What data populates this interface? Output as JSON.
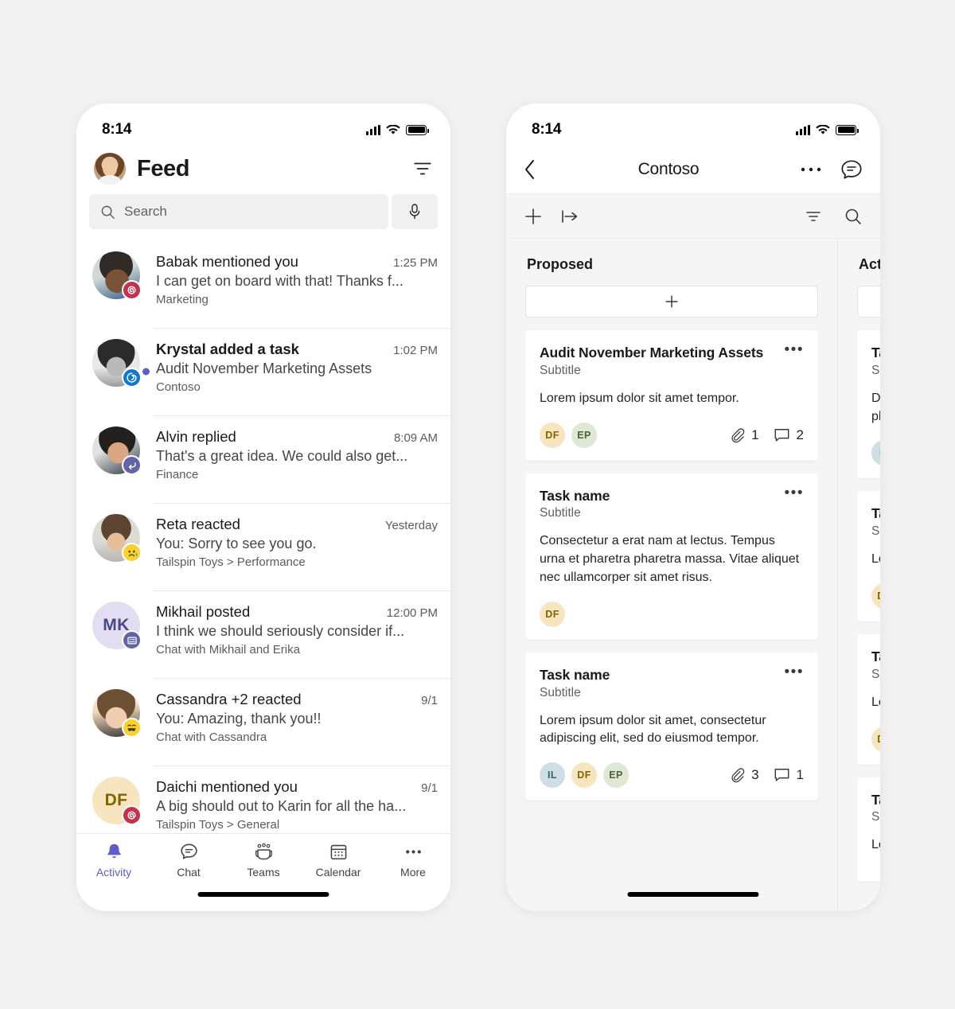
{
  "status_bar": {
    "time": "8:14"
  },
  "feed_screen": {
    "title": "Feed",
    "filter_icon": "filter-icon",
    "search": {
      "placeholder": "Search",
      "icon": "search-icon",
      "mic_icon": "microphone-icon"
    },
    "items": [
      {
        "title": "Babak mentioned you",
        "preview": "I can get on board with that! Thanks f...",
        "context": "Marketing",
        "time": "1:25 PM",
        "bold": false,
        "unread": false,
        "badge": "mention-icon",
        "badge_color": "#c4314b",
        "avatar_type": "photo",
        "photo": "babak"
      },
      {
        "title": "Krystal added a task",
        "preview": "Audit November Marketing Assets",
        "context": "Contoso",
        "time": "1:02 PM",
        "bold": true,
        "unread": true,
        "badge": "planner-task-icon",
        "badge_color": "#0f78d4",
        "avatar_type": "photo",
        "photo": "krystal"
      },
      {
        "title": "Alvin replied",
        "preview": "That's a great idea. We could also get...",
        "context": "Finance",
        "time": "8:09 AM",
        "bold": false,
        "unread": false,
        "badge": "reply-icon",
        "badge_color": "#6264a7",
        "avatar_type": "photo",
        "photo": "alvin"
      },
      {
        "title": "Reta reacted",
        "preview": "You: Sorry to see you go.",
        "context": "Tailspin Toys > Performance",
        "time": "Yesterday",
        "bold": false,
        "unread": false,
        "badge": "sad-emoji-icon",
        "badge_color": "#f8d22a",
        "avatar_type": "photo",
        "photo": "reta"
      },
      {
        "title": "Mikhail posted",
        "preview": "I think we should seriously consider if...",
        "context": "Chat with Mikhail and Erika",
        "time": "12:00 PM",
        "bold": false,
        "unread": false,
        "badge": "post-icon",
        "badge_color": "#6264a7",
        "avatar_type": "initials",
        "initials": "MK",
        "avatar_bg": "#e2ddf0",
        "avatar_fg": "#4a4788"
      },
      {
        "title": "Cassandra +2 reacted",
        "preview": "You: Amazing, thank you!!",
        "context": "Chat with Cassandra",
        "time": "9/1",
        "bold": false,
        "unread": false,
        "badge": "laughing-emoji-icon",
        "badge_color": "#f8d22a",
        "avatar_type": "photo",
        "photo": "cassandra"
      },
      {
        "title": "Daichi mentioned you",
        "preview": "A big should out to Karin for all the ha...",
        "context": "Tailspin Toys > General",
        "time": "9/1",
        "bold": false,
        "unread": false,
        "badge": "mention-icon",
        "badge_color": "#c4314b",
        "avatar_type": "initials",
        "initials": "DF",
        "avatar_bg": "#f6e5bf",
        "avatar_fg": "#836200"
      }
    ],
    "tabs": [
      {
        "label": "Activity",
        "icon": "bell-icon",
        "active": true
      },
      {
        "label": "Chat",
        "icon": "chat-icon",
        "active": false
      },
      {
        "label": "Teams",
        "icon": "teams-icon",
        "active": false
      },
      {
        "label": "Calendar",
        "icon": "calendar-icon",
        "active": false
      },
      {
        "label": "More",
        "icon": "more-icon",
        "active": false
      }
    ],
    "accent_color": "#5b5fc7"
  },
  "board_screen": {
    "nav": {
      "back_icon": "chevron-left-icon",
      "title": "Contoso",
      "more_icon": "more-horizontal-icon",
      "chat_icon": "chat-bubble-icon"
    },
    "toolbar": {
      "add_icon": "plus-icon",
      "group_icon": "group-by-icon",
      "filter_icon": "filter-icon",
      "search_icon": "search-icon"
    },
    "buckets": [
      {
        "title": "Proposed",
        "add_label": "plus-icon",
        "cards": [
          {
            "title": "Audit November Marketing Assets",
            "subtitle": "Subtitle",
            "body": "Lorem ipsum dolor sit amet tempor.",
            "people": [
              {
                "initials": "DF",
                "bg": "#f6e5bf",
                "fg": "#836200"
              },
              {
                "initials": "EP",
                "bg": "#dfe8d5",
                "fg": "#4a6132"
              }
            ],
            "attachments": "1",
            "comments": "2"
          },
          {
            "title": "Task name",
            "subtitle": "Subtitle",
            "body": "Consectetur a erat nam at lectus. Tempus urna et pharetra pharetra massa. Vitae aliquet nec ullamcorper sit amet risus.",
            "people": [
              {
                "initials": "DF",
                "bg": "#f6e5bf",
                "fg": "#836200"
              }
            ],
            "attachments": "",
            "comments": ""
          },
          {
            "title": "Task name",
            "subtitle": "Subtitle",
            "body": "Lorem ipsum dolor sit amet, consectetur adipiscing elit, sed do eiusmod tempor.",
            "people": [
              {
                "initials": "IL",
                "bg": "#cfdee4",
                "fg": "#35606e"
              },
              {
                "initials": "DF",
                "bg": "#f6e5bf",
                "fg": "#836200"
              },
              {
                "initials": "EP",
                "bg": "#dfe8d5",
                "fg": "#4a6132"
              }
            ],
            "attachments": "3",
            "comments": "1"
          }
        ]
      },
      {
        "title": "Active",
        "add_label": "plus-icon",
        "cards": [
          {
            "title": "Task name",
            "subtitle": "Subtitle",
            "body": "Dolor sit amet vel at nec ultricies pharetra pharetra.",
            "people": [
              {
                "initials": "IL",
                "bg": "#cfdee4",
                "fg": "#35606e"
              }
            ],
            "attachments": "",
            "comments": ""
          },
          {
            "title": "Task name",
            "subtitle": "Subtitle",
            "body": "Lorem ipsum dolor sit amet.",
            "people": [
              {
                "initials": "DF",
                "bg": "#f6e5bf",
                "fg": "#836200"
              }
            ],
            "attachments": "",
            "comments": ""
          },
          {
            "title": "Task name",
            "subtitle": "Subtitle",
            "body": "Lorem ipsum dolor sit amet, adipiscing elit.",
            "people": [
              {
                "initials": "DF",
                "bg": "#f6e5bf",
                "fg": "#836200"
              }
            ],
            "attachments": "",
            "comments": ""
          },
          {
            "title": "Task name",
            "subtitle": "Subtitle",
            "body": "Lorem ipsum.",
            "people": [],
            "attachments": "",
            "comments": ""
          }
        ]
      }
    ]
  }
}
